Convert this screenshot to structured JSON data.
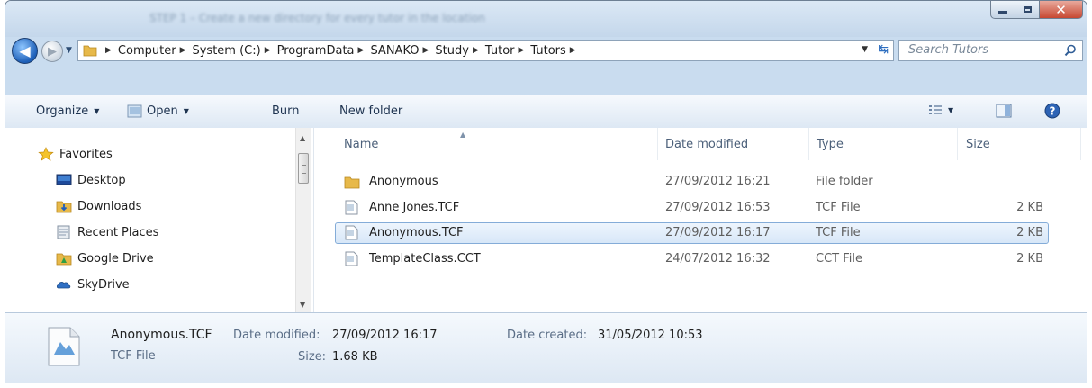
{
  "window": {
    "title": "STEP 1 – Create a new directory for every tutor in the location"
  },
  "address": {
    "crumbs": [
      "Computer",
      "System (C:)",
      "ProgramData",
      "SANAKO",
      "Study",
      "Tutor",
      "Tutors"
    ]
  },
  "search": {
    "placeholder": "Search Tutors"
  },
  "toolbar": {
    "organize": "Organize",
    "open": "Open",
    "burn": "Burn",
    "new_folder": "New folder"
  },
  "navigation": {
    "favorites": "Favorites",
    "items": [
      "Desktop",
      "Downloads",
      "Recent Places",
      "Google Drive",
      "SkyDrive"
    ]
  },
  "columns": {
    "name": "Name",
    "date_modified": "Date modified",
    "type": "Type",
    "size": "Size"
  },
  "files": [
    {
      "name": "Anonymous",
      "date": "27/09/2012 16:21",
      "type": "File folder",
      "size": ""
    },
    {
      "name": "Anne Jones.TCF",
      "date": "27/09/2012 16:53",
      "type": "TCF File",
      "size": "2 KB"
    },
    {
      "name": "Anonymous.TCF",
      "date": "27/09/2012 16:17",
      "type": "TCF File",
      "size": "2 KB"
    },
    {
      "name": "TemplateClass.CCT",
      "date": "24/07/2012 16:32",
      "type": "CCT File",
      "size": "2 KB"
    }
  ],
  "details": {
    "file_name": "Anonymous.TCF",
    "file_type": "TCF File",
    "date_modified_label": "Date modified:",
    "date_modified": "27/09/2012 16:17",
    "size_label": "Size:",
    "size": "1.68 KB",
    "date_created_label": "Date created:",
    "date_created": "31/05/2012 10:53"
  },
  "colors": {
    "accent": "#2f6fc0",
    "selection": "#d7e7f8",
    "chrome": "#c9dcef",
    "close": "#c74832"
  }
}
